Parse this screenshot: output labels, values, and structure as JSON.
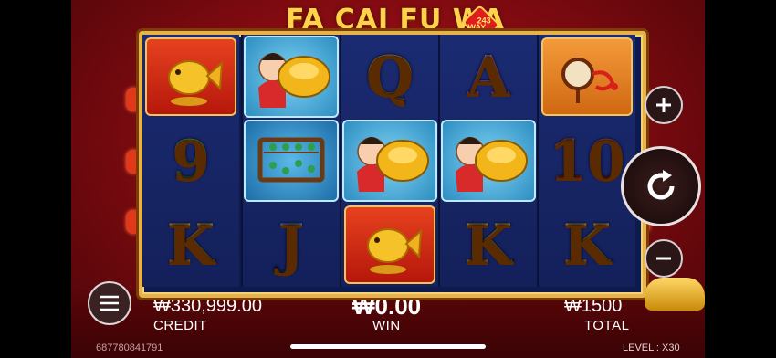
{
  "game": {
    "title": "FA CAI FU WA",
    "ways_top": "243",
    "ways_bottom": "WAY"
  },
  "reels": [
    [
      "golden-fish-symbol",
      "9",
      "K"
    ],
    [
      "fu-wa-boy-gold-ingot-symbol",
      "abacus-symbol",
      "J"
    ],
    [
      "Q",
      "fu-wa-boy-gold-ingot-symbol",
      "golden-fish-symbol"
    ],
    [
      "A",
      "fu-wa-boy-gold-ingot-symbol",
      "K"
    ],
    [
      "drum-symbol",
      "10",
      "K"
    ]
  ],
  "hud": {
    "credit_value": "₩330,999.00",
    "credit_label": "CREDIT",
    "win_value": "₩0.00",
    "win_label": "WIN",
    "total_value": "₩1500",
    "total_label": "TOTAL",
    "session_id": "687780841791",
    "level_text": "LEVEL : X30"
  },
  "controls": {
    "increase_icon": "plus-icon",
    "spin_icon": "spin-arrow-icon",
    "decrease_icon": "minus-icon",
    "menu_icon": "hamburger-menu-icon"
  },
  "colors": {
    "frame_gold": "#e7b24a",
    "reel_bg": "#1b2b72",
    "background_red": "#b3121a"
  }
}
